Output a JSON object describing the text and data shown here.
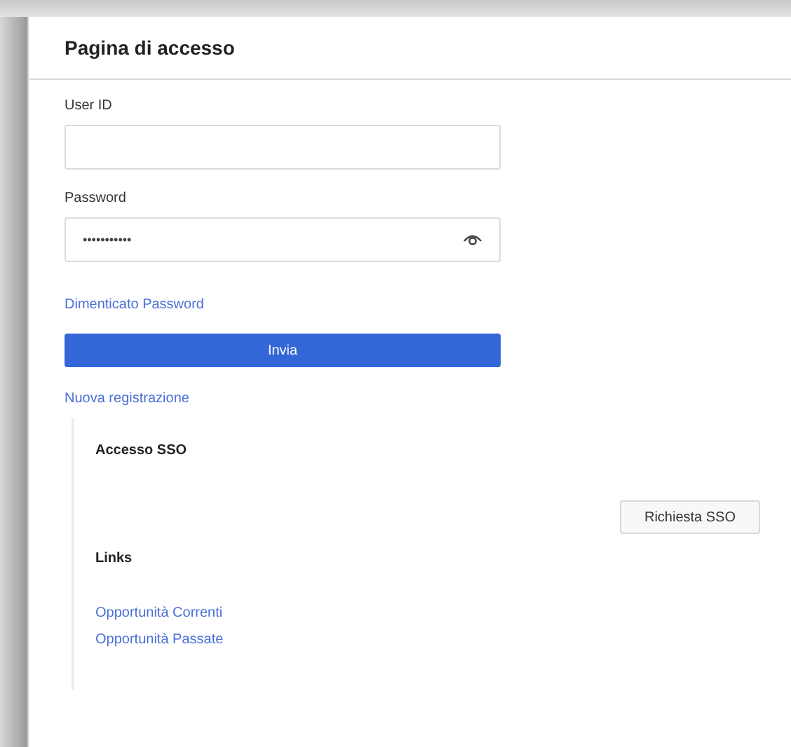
{
  "page": {
    "title": "Pagina di accesso"
  },
  "form": {
    "fields": [
      {
        "label": "User ID",
        "kind": "text"
      },
      {
        "label": "Password",
        "kind": "password",
        "value": "•••••••••••"
      }
    ],
    "forgot_link": "Dimenticato Password",
    "submit_button": "Invia",
    "register_link": "Nuova registrazione"
  },
  "sso": {
    "heading": "Accesso SSO",
    "button": "Richiesta SSO"
  },
  "links": {
    "heading": "Links",
    "items": [
      "Opportunità Correnti",
      "Opportunità Passate"
    ]
  }
}
